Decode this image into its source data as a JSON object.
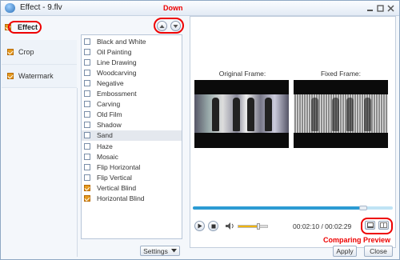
{
  "window": {
    "title": "Effect - 9.flv"
  },
  "sidebar": {
    "effect": {
      "label": "Effect",
      "checked": true
    },
    "items": [
      {
        "label": "Crop",
        "checked": true
      },
      {
        "label": "Watermark",
        "checked": true
      }
    ]
  },
  "effects": [
    {
      "label": "Black and White",
      "checked": false
    },
    {
      "label": "Oil Painting",
      "checked": false
    },
    {
      "label": "Line Drawing",
      "checked": false
    },
    {
      "label": "Woodcarving",
      "checked": false
    },
    {
      "label": "Negative",
      "checked": false
    },
    {
      "label": "Embossment",
      "checked": false
    },
    {
      "label": "Carving",
      "checked": false
    },
    {
      "label": "Old Film",
      "checked": false
    },
    {
      "label": "Shadow",
      "checked": false
    },
    {
      "label": "Sand",
      "checked": false,
      "selected": true
    },
    {
      "label": "Haze",
      "checked": false
    },
    {
      "label": "Mosaic",
      "checked": false
    },
    {
      "label": "Flip Horizontal",
      "checked": false
    },
    {
      "label": "Flip Vertical",
      "checked": false
    },
    {
      "label": "Vertical Blind",
      "checked": true
    },
    {
      "label": "Horizontal Blind",
      "checked": true
    }
  ],
  "annotations": {
    "down": "Down",
    "up": "Up",
    "comparing_preview": "Comparing Preview"
  },
  "settings_label": "Settings",
  "preview": {
    "original_caption": "Original Frame:",
    "fixed_caption": "Fixed Frame:"
  },
  "player": {
    "progress_fraction": 0.85,
    "volume_fraction": 0.7,
    "time": "00:02:10 / 00:02:29"
  },
  "buttons": {
    "apply": "Apply",
    "close": "Close"
  },
  "colors": {
    "annotation": "#e00000",
    "check": "#e59a1f",
    "progress": "#2c9bd3"
  }
}
